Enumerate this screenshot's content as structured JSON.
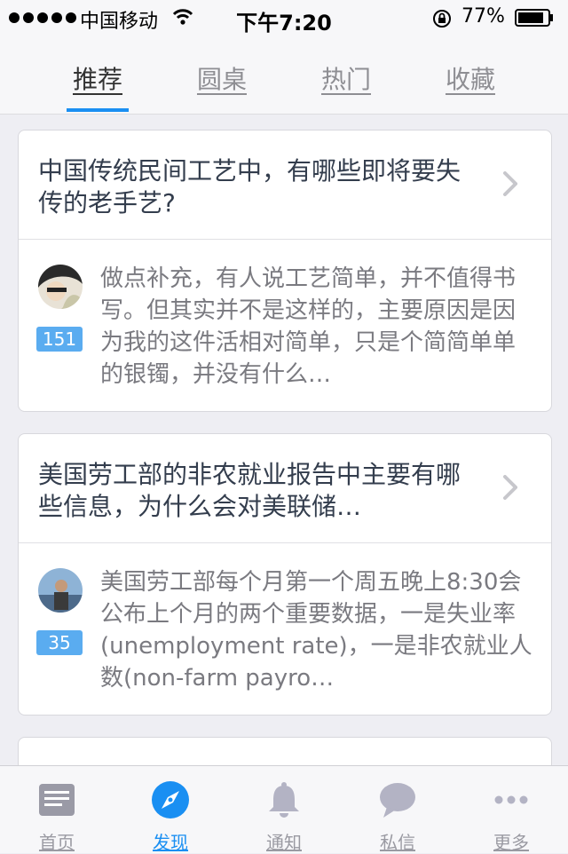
{
  "status_bar": {
    "carrier": "中国移动",
    "time": "下午7:20",
    "battery": "77%"
  },
  "tabs": [
    {
      "label": "推荐"
    },
    {
      "label": "圆桌"
    },
    {
      "label": "热门"
    },
    {
      "label": "收藏"
    }
  ],
  "cards": [
    {
      "question": "中国传统民间工艺中，有哪些即将要失传的老手艺?",
      "votes": "151",
      "answer": "做点补充，有人说工艺简单，并不值得书写。但其实并不是这样的，主要原因是因为我的这件活相对简单，只是个简简单单的银镯，并没有什么…"
    },
    {
      "question": "美国劳工部的非农就业报告中主要有哪些信息，为什么会对美联储…",
      "votes": "35",
      "answer": "美国劳工部每个月第一个周五晚上8:30会公布上个月的两个重要数据，一是失业率(unemployment rate)，一是非农就业人数(non-farm payro…"
    }
  ],
  "bottom_nav": [
    {
      "label": "首页",
      "icon": "news-icon"
    },
    {
      "label": "发现",
      "icon": "compass-icon"
    },
    {
      "label": "通知",
      "icon": "bell-icon"
    },
    {
      "label": "私信",
      "icon": "chat-icon"
    },
    {
      "label": "更多",
      "icon": "more-icon"
    }
  ],
  "colors": {
    "accent": "#1a8ff2",
    "vote_badge": "#5aacf0"
  }
}
